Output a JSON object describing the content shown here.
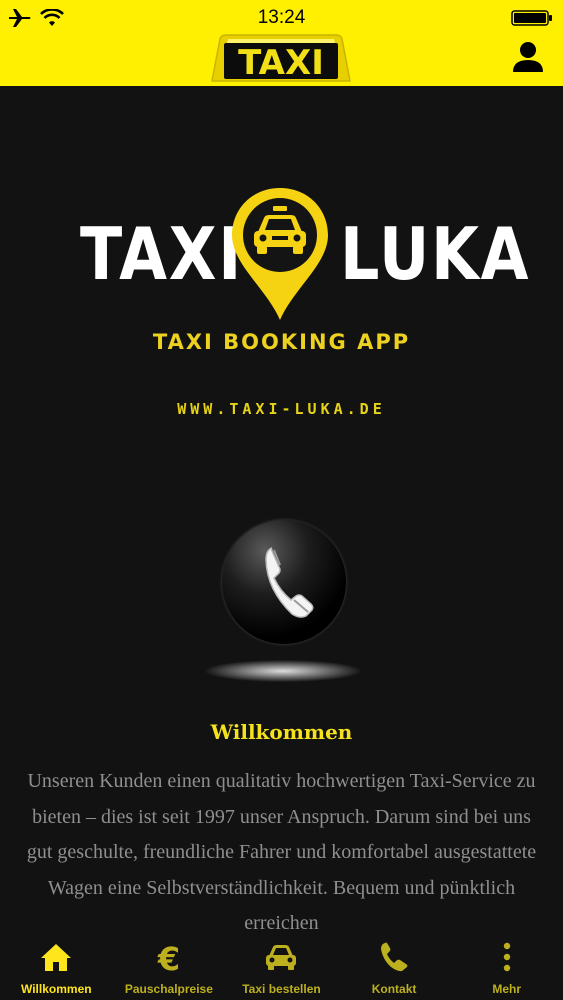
{
  "status_bar": {
    "time": "13:24"
  },
  "header": {
    "sign_text": "TAXI"
  },
  "logo": {
    "left_text": "TAXI",
    "right_text": "LUKA"
  },
  "tagline": "TAXI BOOKING APP",
  "website": "WWW.TAXI-LUKA.DE",
  "content": {
    "heading": "Willkommen",
    "body": "Unseren Kunden einen qualitativ hochwertigen Taxi-Service zu bieten – dies ist seit 1997 unser Anspruch. Darum sind bei uns gut geschulte, freundliche Fahrer und komfortabel ausgestattete Wagen eine Selbstverständlichkeit. Bequem und pünktlich erreichen"
  },
  "nav": {
    "items": [
      {
        "label": "Willkommen",
        "icon": "home-icon",
        "active": true
      },
      {
        "label": "Pauschalpreise",
        "icon": "euro-icon"
      },
      {
        "label": "Taxi bestellen",
        "icon": "car-icon"
      },
      {
        "label": "Kontakt",
        "icon": "phone-icon"
      },
      {
        "label": "Mehr",
        "icon": "more-icon"
      }
    ]
  },
  "colors": {
    "accent": "#fef000",
    "background": "#121212",
    "text_muted": "#8f8f8f",
    "nav_inactive": "#bdb01f"
  }
}
